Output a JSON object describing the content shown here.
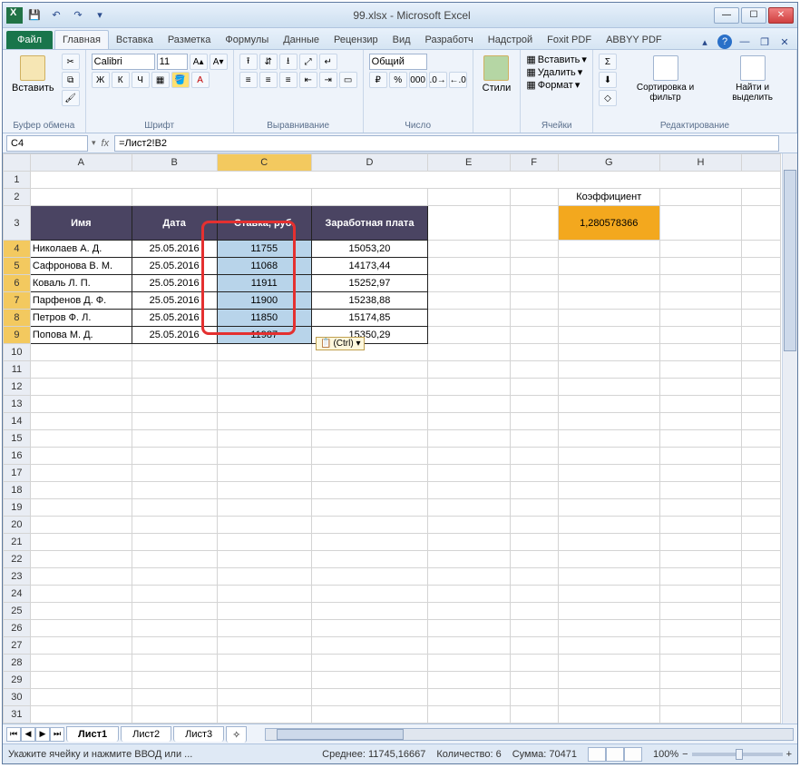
{
  "window": {
    "title": "99.xlsx - Microsoft Excel"
  },
  "qat": {
    "save": "💾",
    "undo": "↶",
    "redo": "↷"
  },
  "tabs": {
    "file": "Файл",
    "items": [
      "Главная",
      "Вставка",
      "Разметка",
      "Формулы",
      "Данные",
      "Рецензир",
      "Вид",
      "Разработч",
      "Надстрой",
      "Foxit PDF",
      "ABBYY PDF"
    ],
    "active": 0
  },
  "ribbon": {
    "clipboard": {
      "paste": "Вставить",
      "title": "Буфер обмена"
    },
    "font": {
      "name": "Calibri",
      "size": "11",
      "title": "Шрифт",
      "bold": "Ж",
      "italic": "К",
      "underline": "Ч"
    },
    "align": {
      "title": "Выравнивание"
    },
    "number": {
      "format": "Общий",
      "title": "Число"
    },
    "styles": {
      "btn": "Стили",
      "title": ""
    },
    "cells": {
      "insert": "Вставить",
      "delete": "Удалить",
      "format": "Формат",
      "title": "Ячейки"
    },
    "editing": {
      "sort": "Сортировка и фильтр",
      "find": "Найти и выделить",
      "title": "Редактирование"
    }
  },
  "formula_bar": {
    "namebox": "C4",
    "fx": "fx",
    "formula": "=Лист2!B2"
  },
  "columns": [
    "A",
    "B",
    "C",
    "D",
    "E",
    "F",
    "G",
    "H"
  ],
  "table": {
    "headers": {
      "name": "Имя",
      "date": "Дата",
      "rate": "Ставка, руб.",
      "salary": "Заработная плата"
    },
    "rows": [
      {
        "name": "Николаев А. Д.",
        "date": "25.05.2016",
        "rate": "11755",
        "salary": "15053,20"
      },
      {
        "name": "Сафронова В. М.",
        "date": "25.05.2016",
        "rate": "11068",
        "salary": "14173,44"
      },
      {
        "name": "Коваль Л. П.",
        "date": "25.05.2016",
        "rate": "11911",
        "salary": "15252,97"
      },
      {
        "name": "Парфенов Д. Ф.",
        "date": "25.05.2016",
        "rate": "11900",
        "salary": "15238,88"
      },
      {
        "name": "Петров Ф. Л.",
        "date": "25.05.2016",
        "rate": "11850",
        "salary": "15174,85"
      },
      {
        "name": "Попова М. Д.",
        "date": "25.05.2016",
        "rate": "11987",
        "salary": "15350,29"
      }
    ],
    "koef_label": "Коэффициент",
    "koef_value": "1,280578366"
  },
  "paste_tag": "(Ctrl) ▾",
  "sheets": {
    "items": [
      "Лист1",
      "Лист2",
      "Лист3"
    ],
    "active": 0
  },
  "status": {
    "mode": "Укажите ячейку и нажмите ВВОД или ...",
    "avg_label": "Среднее:",
    "avg": "11745,16667",
    "count_label": "Количество:",
    "count": "6",
    "sum_label": "Сумма:",
    "sum": "70471",
    "zoom": "100%"
  }
}
